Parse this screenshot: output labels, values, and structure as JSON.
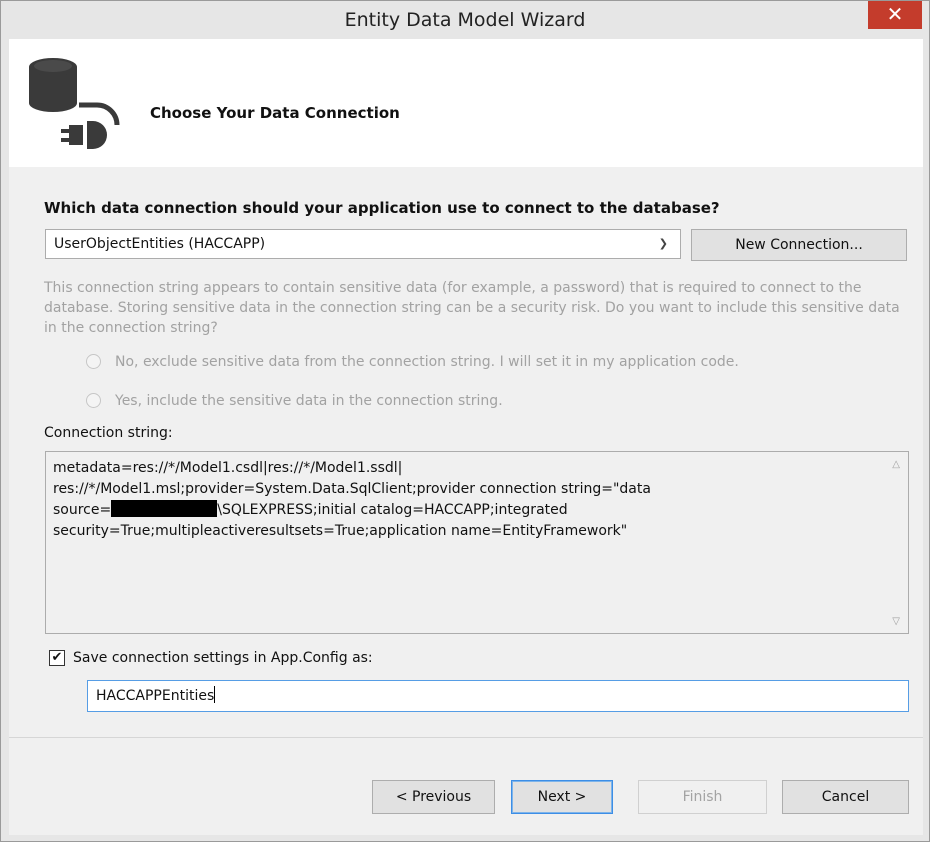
{
  "window": {
    "title": "Entity Data Model Wizard",
    "close_glyph": "✕"
  },
  "header": {
    "title": "Choose Your Data Connection",
    "icon": "database-plug-icon"
  },
  "connection": {
    "question": "Which data connection should your application use to connect to the database?",
    "selected": "UserObjectEntities (HACCAPP)",
    "new_button": "New Connection..."
  },
  "sensitive": {
    "description": "This connection string appears to contain sensitive data (for example, a password) that is required to connect to the database. Storing sensitive data in the connection string can be a security risk. Do you want to include this sensitive data in the connection string?",
    "option_no": "No, exclude sensitive data from the connection string. I will set it in my application code.",
    "option_yes": "Yes, include the sensitive data in the connection string."
  },
  "connection_string": {
    "label": "Connection string:",
    "line1": "metadata=res://*/Model1.csdl|res://*/Model1.ssdl|",
    "line2": "res://*/Model1.msl;provider=System.Data.SqlClient;provider connection string=\"data",
    "line3_prefix": "source=",
    "line3_suffix": "\\SQLEXPRESS;initial catalog=HACCAPP;integrated",
    "line4": "security=True;multipleactiveresultsets=True;application name=EntityFramework\""
  },
  "save_settings": {
    "checked": true,
    "check_glyph": "✔",
    "label": "Save connection settings in App.Config as:",
    "value": "HACCAPPEntities"
  },
  "buttons": {
    "previous": "< Previous",
    "next": "Next >",
    "finish": "Finish",
    "cancel": "Cancel"
  },
  "colors": {
    "close": "#c43c2c",
    "focus_border": "#569de5",
    "disabled_text": "#a2a2a2"
  }
}
